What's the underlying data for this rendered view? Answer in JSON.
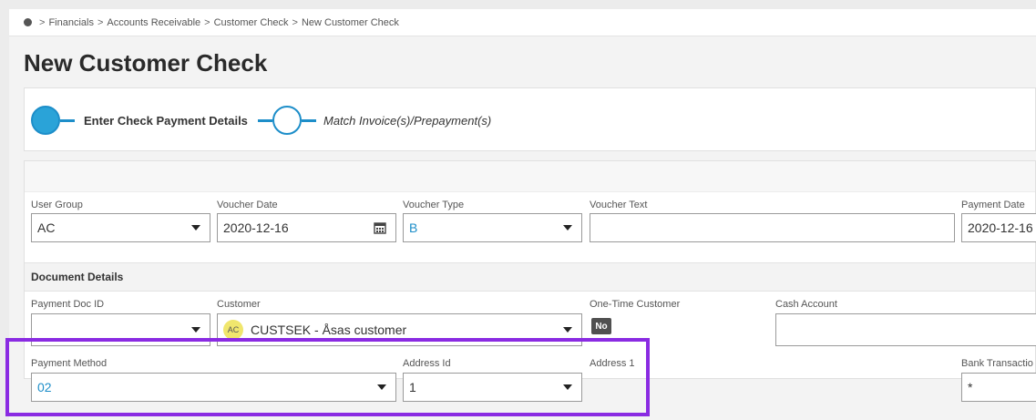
{
  "breadcrumb": {
    "items": [
      "Financials",
      "Accounts Receivable",
      "Customer Check",
      "New Customer Check"
    ],
    "sep": ">"
  },
  "page_title": "New Customer Check",
  "steps": [
    {
      "label": "Enter Check Payment Details",
      "state": "active"
    },
    {
      "label": "Match Invoice(s)/Prepayment(s)",
      "state": "pending"
    }
  ],
  "form": {
    "user_group": {
      "label": "User Group",
      "value": "AC"
    },
    "voucher_date": {
      "label": "Voucher Date",
      "value": "2020-12-16"
    },
    "voucher_type": {
      "label": "Voucher Type",
      "value": "B"
    },
    "voucher_text": {
      "label": "Voucher Text",
      "value": ""
    },
    "payment_date": {
      "label": "Payment Date",
      "value": "2020-12-16"
    }
  },
  "document_details": {
    "title": "Document Details",
    "payment_doc_id": {
      "label": "Payment Doc ID",
      "value": ""
    },
    "customer": {
      "label": "Customer",
      "avatar": "AC",
      "value": "CUSTSEK - Åsas customer"
    },
    "one_time_customer": {
      "label": "One-Time Customer",
      "value": "No"
    },
    "cash_account": {
      "label": "Cash Account",
      "value": ""
    },
    "payment_method": {
      "label": "Payment Method",
      "value": "02"
    },
    "address_id": {
      "label": "Address Id",
      "value": "1"
    },
    "address_1": {
      "label": "Address 1"
    },
    "bank_transaction": {
      "label": "Bank Transactio",
      "value": "*"
    }
  },
  "colors": {
    "accent": "#1d8ec9",
    "highlight": "#8a2be2"
  }
}
